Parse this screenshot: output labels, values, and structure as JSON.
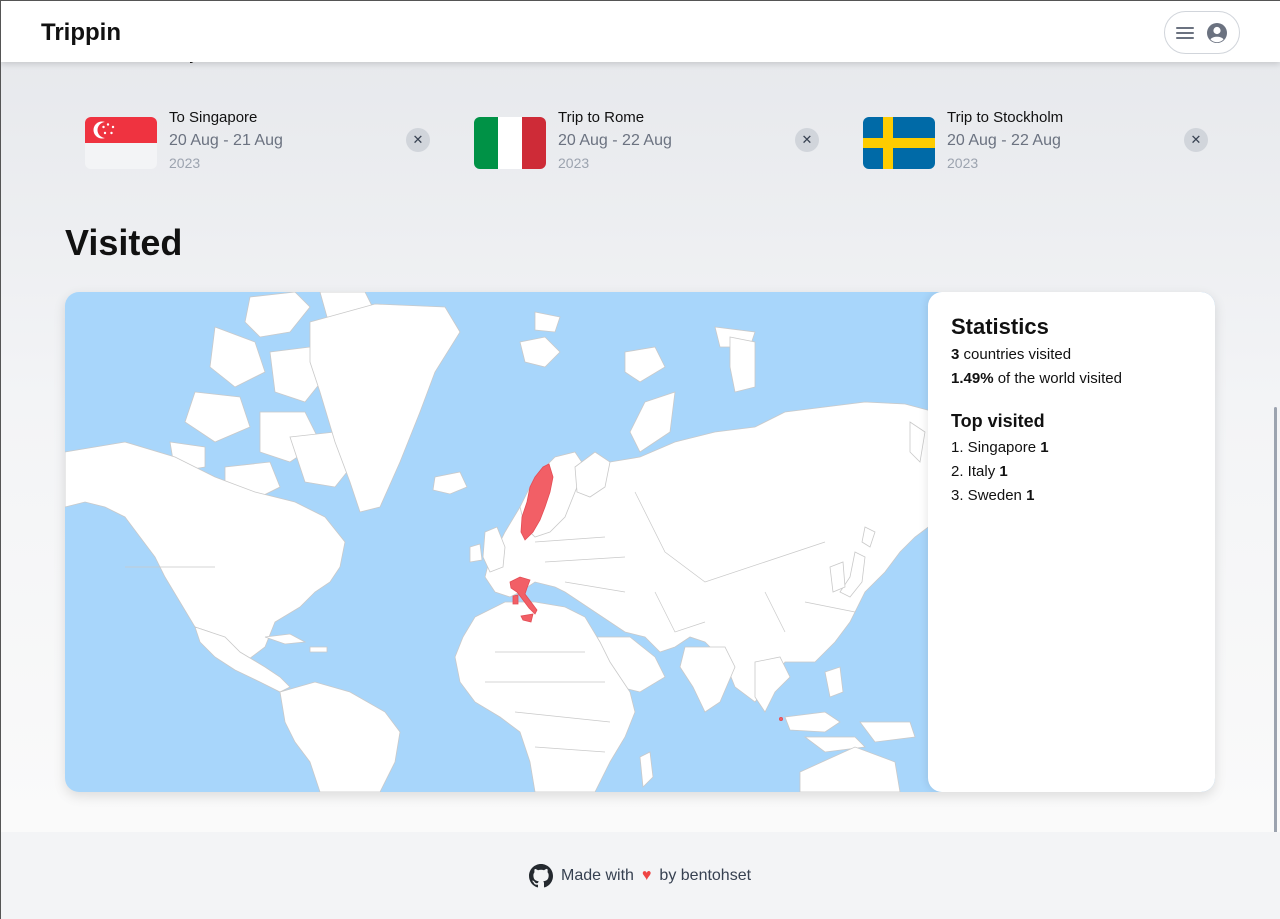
{
  "app": {
    "title": "Trippin"
  },
  "navbar": {
    "menu_icon": "hamburger-icon",
    "profile_icon": "user-circle-icon"
  },
  "trips": [
    {
      "title": "To Singapore",
      "dates": "20 Aug - 21 Aug",
      "year": "2023",
      "flag": "singapore-flag",
      "close": "✕"
    },
    {
      "title": "Trip to Rome",
      "dates": "20 Aug - 22 Aug",
      "year": "2023",
      "flag": "italy-flag",
      "close": "✕"
    },
    {
      "title": "Trip to Stockholm",
      "dates": "20 Aug - 22 Aug",
      "year": "2023",
      "flag": "sweden-flag",
      "close": "✕"
    }
  ],
  "visited": {
    "title": "Visited",
    "highlighted_countries": [
      "Sweden",
      "Italy",
      "Singapore"
    ],
    "colors": {
      "ocean": "#a8d6fb",
      "land": "#ffffff",
      "visited": "#f25f66"
    }
  },
  "statistics": {
    "title": "Statistics",
    "countries_count": "3",
    "countries_label": " countries visited",
    "world_percent": "1.49%",
    "world_label": " of the world visited",
    "top_title": "Top visited",
    "top": [
      {
        "rank": "1.",
        "name": " Singapore ",
        "count": "1"
      },
      {
        "rank": "2.",
        "name": " Italy ",
        "count": "1"
      },
      {
        "rank": "3.",
        "name": " Sweden ",
        "count": "1"
      }
    ]
  },
  "footer": {
    "made_with": "Made with",
    "by": "by bentohset",
    "icon": "github-icon",
    "heart_icon": "heart-icon",
    "heart": "♥"
  }
}
